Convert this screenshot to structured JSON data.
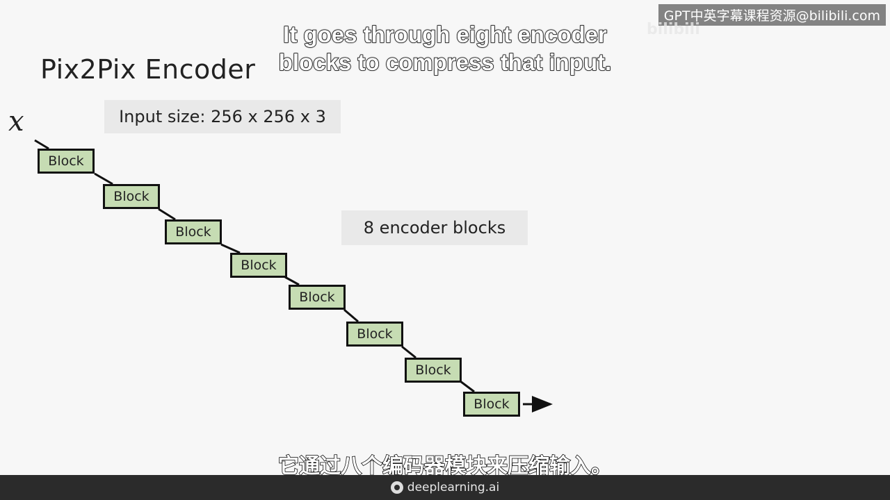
{
  "slide": {
    "title": "Pix2Pix Encoder",
    "input_symbol": "x",
    "input_size_label": "Input size: 256 x 256 x 3",
    "encoder_count_label": "8 encoder blocks",
    "blocks": [
      "Block",
      "Block",
      "Block",
      "Block",
      "Block",
      "Block",
      "Block",
      "Block"
    ]
  },
  "subtitles": {
    "english": "It goes through eight encoder blocks to compress that input.",
    "chinese": "它通过八个编码器模块来压缩输入。"
  },
  "watermark": {
    "text": "GPT中英字幕课程资源@bilibili.com",
    "logo": "bilibili"
  },
  "footer": {
    "brand": "deeplearning.ai",
    "icon": "deeplearning-logo-icon"
  },
  "colors": {
    "block_fill": "#c6dcb3",
    "block_border": "#111111",
    "chip_bg": "#e9e9e9",
    "footer_bg": "#2b2b2b"
  }
}
